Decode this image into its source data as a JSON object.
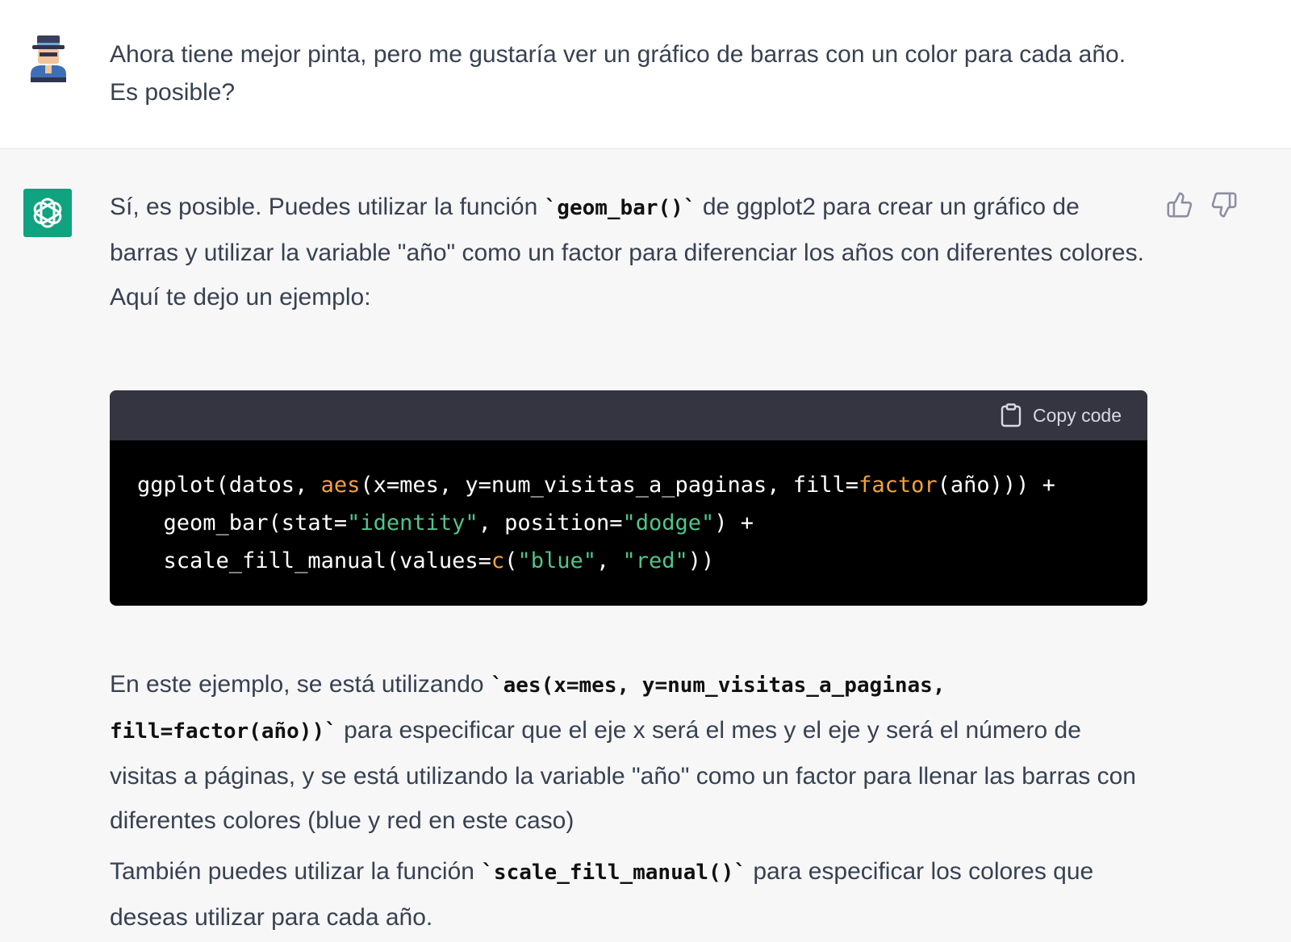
{
  "user_message": {
    "text": "Ahora tiene mejor pinta, pero me gustaría ver un gráfico de barras con un color para cada año. Es posible?"
  },
  "assistant_message": {
    "p1_a": "Sí, es posible. Puedes utilizar la función ",
    "p1_code": "`geom_bar()`",
    "p1_b": " de ggplot2 para crear un gráfico de barras y utilizar la variable \"año\" como un factor para diferenciar los años con diferentes colores. Aquí te dejo un ejemplo:",
    "code_block": {
      "copy_label": "Copy code",
      "line1": {
        "t1": "ggplot(datos, ",
        "f1": "aes",
        "t2": "(x=mes, y=num_visitas_a_paginas, fill=",
        "f2": "factor",
        "t3": "(año))) +"
      },
      "line2": {
        "t1": "  geom_bar(stat=",
        "s1": "\"identity\"",
        "t2": ", position=",
        "s2": "\"dodge\"",
        "t3": ") +"
      },
      "line3": {
        "t1": "  scale_fill_manual(values=",
        "f1": "c",
        "t2": "(",
        "s1": "\"blue\"",
        "t3": ", ",
        "s2": "\"red\"",
        "t4": "))"
      }
    },
    "p2_a": "En este ejemplo, se está utilizando ",
    "p2_code": "`aes(x=mes, y=num_visitas_a_paginas, fill=factor(año))`",
    "p2_b": " para especificar que el eje x será el mes y el eje y será el número de visitas a páginas, y se está utilizando la variable \"año\" como un factor para llenar las barras con diferentes colores (blue y red en este caso)",
    "p3_a": "También puedes utilizar la función ",
    "p3_code": "`scale_fill_manual()`",
    "p3_b": " para especificar los colores que deseas utilizar para cada año."
  },
  "icons": {
    "user_avatar": "hat-person-icon",
    "assistant_avatar": "openai-logo-icon",
    "copy": "clipboard-icon",
    "like": "thumbs-up-icon",
    "dislike": "thumbs-down-icon"
  },
  "colors": {
    "assistant_avatar_bg": "#10a37f",
    "code_bg": "#000000",
    "code_header_bg": "#343541",
    "code_function": "#f2a33a",
    "code_string": "#4fc58a"
  }
}
